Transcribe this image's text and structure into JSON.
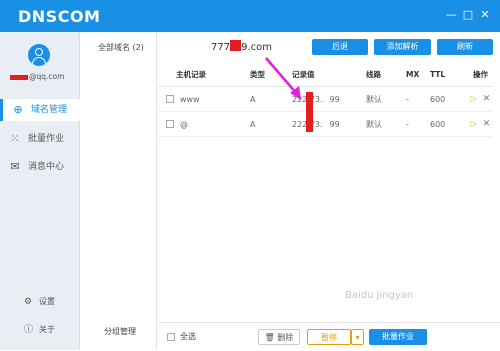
{
  "app": {
    "logo": "DNSCOM"
  },
  "window_controls": [
    {
      "icon": "minimize-icon",
      "glyph": "—"
    },
    {
      "icon": "maximize-icon",
      "glyph": "□"
    },
    {
      "icon": "close-icon",
      "glyph": "✕"
    }
  ],
  "user": {
    "email_suffix": "@qq.com"
  },
  "sidebar": {
    "items": [
      {
        "label": "域名管理",
        "icon": "globe-icon",
        "glyph": "⊕"
      },
      {
        "label": "批量作业",
        "icon": "grid-icon",
        "glyph": "⁙"
      },
      {
        "label": "消息中心",
        "icon": "message-icon",
        "glyph": "✉"
      }
    ],
    "bottom": [
      {
        "label": "设置",
        "icon": "gear-icon",
        "glyph": "⚙"
      },
      {
        "label": "关于",
        "icon": "info-icon",
        "glyph": "ⓘ"
      }
    ]
  },
  "groups": {
    "all_label": "全部域名 (2)",
    "manage_label": "分组管理"
  },
  "main": {
    "domain_prefix": "777",
    "domain_suffix": "9.com",
    "buttons": {
      "back": "后退",
      "add": "添加解析",
      "refresh": "刷新"
    }
  },
  "table": {
    "headers": [
      "主机记录",
      "类型",
      "记录值",
      "线路",
      "MX",
      "TTL",
      "操作"
    ],
    "rows": [
      {
        "host": "www",
        "type": "A",
        "value": "222.73.",
        "value_end": "99",
        "line": "默认",
        "mx": "-",
        "ttl": "600"
      },
      {
        "host": "@",
        "type": "A",
        "value": "222.73.",
        "value_end": "99",
        "line": "默认",
        "mx": "-",
        "ttl": "600"
      }
    ]
  },
  "footer": {
    "select_all": "全选",
    "delete": "删除",
    "pause": "暂停",
    "batch": "批量作业"
  },
  "watermark": "Baidu jingyan",
  "colors": {
    "accent": "#1a8fe6",
    "highlight": "#e02020",
    "annotation": "#e020e0"
  }
}
